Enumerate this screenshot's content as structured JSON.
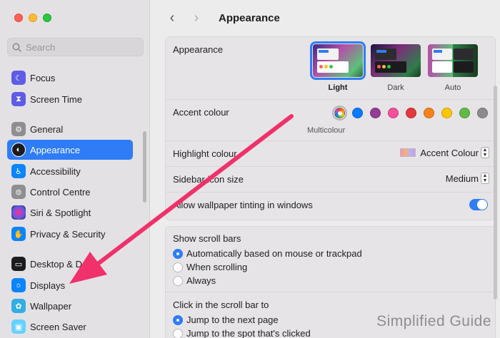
{
  "sidebar": {
    "search_placeholder": "Search",
    "items": [
      {
        "label": "Focus",
        "icon": "moon-icon",
        "color": "#5e5ce6"
      },
      {
        "label": "Screen Time",
        "icon": "hourglass-icon",
        "color": "#5e5ce6"
      },
      {
        "label": "General",
        "icon": "gear-icon",
        "color": "#8e8e93"
      },
      {
        "label": "Appearance",
        "icon": "appearance-icon",
        "color": "#1c1c1e"
      },
      {
        "label": "Accessibility",
        "icon": "accessibility-icon",
        "color": "#0a84ff"
      },
      {
        "label": "Control Centre",
        "icon": "toggles-icon",
        "color": "#8e8e93"
      },
      {
        "label": "Siri & Spotlight",
        "icon": "siri-icon",
        "color": "#2c2c2e"
      },
      {
        "label": "Privacy & Security",
        "icon": "hand-icon",
        "color": "#0a84ff"
      },
      {
        "label": "Desktop & Dock",
        "icon": "dock-icon",
        "color": "#1c1c1e"
      },
      {
        "label": "Displays",
        "icon": "sun-icon",
        "color": "#0a84ff"
      },
      {
        "label": "Wallpaper",
        "icon": "flower-icon",
        "color": "#32ade6"
      },
      {
        "label": "Screen Saver",
        "icon": "screensaver-icon",
        "color": "#64d2ff"
      }
    ]
  },
  "toolbar": {
    "back_glyph": "‹",
    "forward_glyph": "›",
    "title": "Appearance"
  },
  "appearance": {
    "label": "Appearance",
    "options": [
      "Light",
      "Dark",
      "Auto"
    ],
    "selected": "Light"
  },
  "accent": {
    "label": "Accent colour",
    "selected_name": "Multicolour",
    "colors": [
      "multicolor",
      "#0a7aff",
      "#953d96",
      "#f74f9e",
      "#e0383e",
      "#f7821b",
      "#ffc600",
      "#62ba46",
      "#8c8c8c"
    ]
  },
  "highlight": {
    "label": "Highlight colour",
    "value": "Accent Colour"
  },
  "sidebar_icon_size": {
    "label": "Sidebar icon size",
    "value": "Medium"
  },
  "tinting": {
    "label": "Allow wallpaper tinting in windows",
    "enabled": true
  },
  "scroll_bars": {
    "label": "Show scroll bars",
    "options": [
      "Automatically based on mouse or trackpad",
      "When scrolling",
      "Always"
    ],
    "selected_index": 0
  },
  "click_scroll": {
    "label": "Click in the scroll bar to",
    "options": [
      "Jump to the next page",
      "Jump to the spot that's clicked"
    ],
    "selected_index": 0
  },
  "watermark": "Simplified Guide",
  "colors": {
    "accent": "#2e7cf6",
    "annotation_arrow": "#f0316c"
  }
}
